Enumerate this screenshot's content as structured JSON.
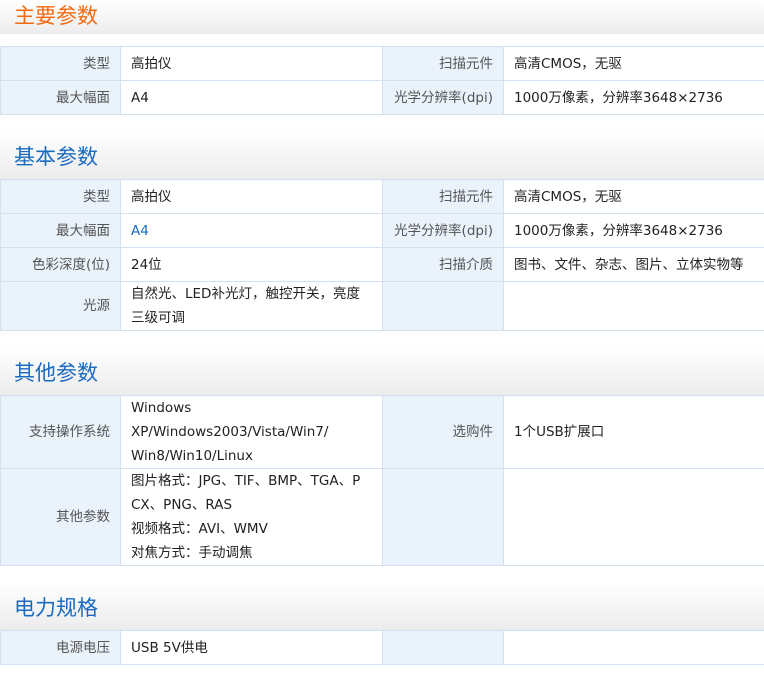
{
  "sections": {
    "main": {
      "title": "主要参数",
      "rows": [
        {
          "k1": "类型",
          "v1": "高拍仪",
          "k2": "扫描元件",
          "v2": "高清CMOS，无驱"
        },
        {
          "k1": "最大幅面",
          "v1": "A4",
          "k2": "光学分辨率(dpi)",
          "v2": "1000万像素，分辨率3648×2736"
        }
      ]
    },
    "basic": {
      "title": "基本参数",
      "rows": [
        {
          "k1": "类型",
          "v1": "高拍仪",
          "k2": "扫描元件",
          "v2": "高清CMOS，无驱"
        },
        {
          "k1": "最大幅面",
          "v1": "A4",
          "k2": "光学分辨率(dpi)",
          "v2": "1000万像素，分辨率3648×2736"
        },
        {
          "k1": "色彩深度(位)",
          "v1": "24位",
          "k2": "扫描介质",
          "v2": "图书、文件、杂志、图片、立体实物等"
        },
        {
          "k1": "光源",
          "v1_lines": [
            "自然光、LED补光灯，触控开关，亮度",
            "三级可调"
          ],
          "k2": "",
          "v2": ""
        }
      ]
    },
    "other": {
      "title": "其他参数",
      "rows": [
        {
          "k1": "支持操作系统",
          "v1_lines": [
            "Windows XP/Windows2003/Vista/Win7/",
            "Win8/Win10/Linux"
          ],
          "k2": "选购件",
          "v2": "1个USB扩展口"
        },
        {
          "k1": "其他参数",
          "v1_lines": [
            "图片格式：JPG、TIF、BMP、TGA、P",
            "CX、PNG、RAS",
            "视频格式：AVI、WMV",
            "对焦方式：手动调焦"
          ],
          "k2": "",
          "v2": ""
        }
      ]
    },
    "power": {
      "title": "电力规格",
      "rows": [
        {
          "k1": "电源电压",
          "v1": "USB 5V供电",
          "k2": "",
          "v2": ""
        }
      ]
    }
  }
}
